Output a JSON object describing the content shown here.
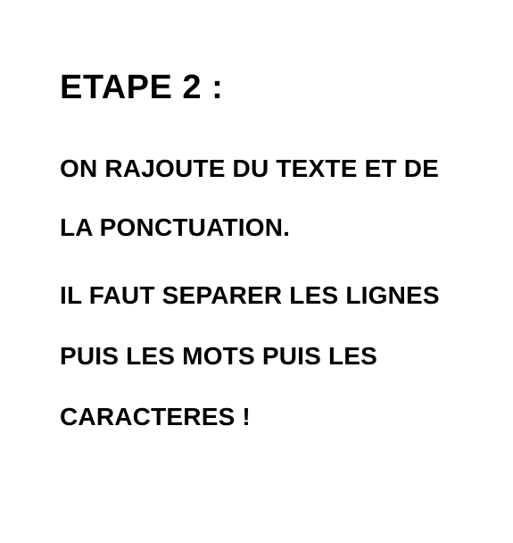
{
  "document": {
    "title": "ETAPE 2 :",
    "lines": [
      "ON RAJOUTE DU TEXTE ET DE",
      "LA PONCTUATION.",
      "IL FAUT SEPARER LES LIGNES",
      "PUIS LES MOTS PUIS LES",
      "CARACTERES !"
    ]
  }
}
